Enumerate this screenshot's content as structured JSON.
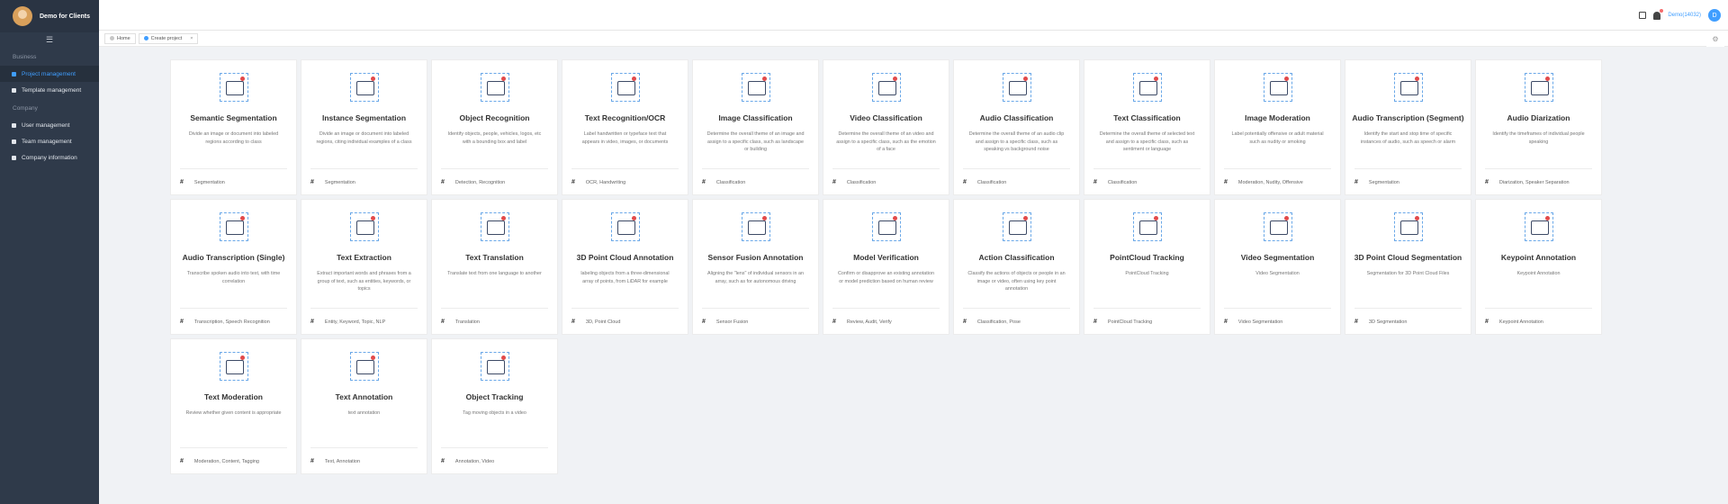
{
  "app": {
    "title": "Demo for Clients"
  },
  "sidebar": {
    "groups": [
      {
        "label": "Business",
        "items": [
          {
            "label": "Project management",
            "active": true
          },
          {
            "label": "Template management",
            "active": false
          }
        ]
      },
      {
        "label": "Company",
        "items": [
          {
            "label": "User management",
            "active": false
          },
          {
            "label": "Team management",
            "active": false
          },
          {
            "label": "Company information",
            "active": false
          }
        ]
      }
    ]
  },
  "header": {
    "username": "Demo(14032)",
    "avatar_letter": "D"
  },
  "tabs": [
    {
      "label": "Home",
      "active": false,
      "closable": false
    },
    {
      "label": "Create project",
      "active": true,
      "closable": true
    }
  ],
  "cards": [
    {
      "title": "Semantic Segmentation",
      "desc": "Divide an image or document into labeled regions according to class",
      "tags": [
        "Segmentation"
      ],
      "icon": "semantic-segmentation-icon"
    },
    {
      "title": "Instance Segmentation",
      "desc": "Divide an image or document into labeled regions, citing individual examples of a class",
      "tags": [
        "Segmentation"
      ],
      "icon": "instance-segmentation-icon"
    },
    {
      "title": "Object Recognition",
      "desc": "Identify objects, people, vehicles, logos, etc with a bounding box and label",
      "tags": [
        "Detection, Recognition"
      ],
      "icon": "object-recognition-icon"
    },
    {
      "title": "Text Recognition/OCR",
      "desc": "Label handwritten or typeface text that appears in video, images, or documents",
      "tags": [
        "OCR, Handwriting"
      ],
      "icon": "ocr-icon"
    },
    {
      "title": "Image Classification",
      "desc": "Determine the overall theme of an image and assign to a specific class, such as landscape or building",
      "tags": [
        "Classification"
      ],
      "icon": "image-classification-icon"
    },
    {
      "title": "Video Classification",
      "desc": "Determine the overall theme of an video and assign to a specific class, such as the emotion of a face",
      "tags": [
        "Classification"
      ],
      "icon": "video-classification-icon"
    },
    {
      "title": "Audio Classification",
      "desc": "Determine the overall theme of an audio clip and assign to a specific class, such as speaking vs background noise",
      "tags": [
        "Classification"
      ],
      "icon": "audio-classification-icon"
    },
    {
      "title": "Text Classification",
      "desc": "Determine the overall theme of selected text and assign to a specific class, such as sentiment or language",
      "tags": [
        "Classification"
      ],
      "icon": "text-classification-icon"
    },
    {
      "title": "Image Moderation",
      "desc": "Label potentially offensive or adult material such as nudity or smoking",
      "tags": [
        "Moderation, Nudity, Offensive"
      ],
      "icon": "image-moderation-icon"
    },
    {
      "title": "Audio Transcription (Segment)",
      "desc": "Identify the start and stop time of specific instances of audio, such as speech or alarm",
      "tags": [
        "Segmentation"
      ],
      "icon": "audio-transcription-segment-icon"
    },
    {
      "title": "Audio Diarization",
      "desc": "Identify the timeframes of individual people speaking",
      "tags": [
        "Diarization, Speaker Separation"
      ],
      "icon": "audio-diarization-icon"
    },
    {
      "title": "Audio Transcription (Single)",
      "desc": "Transcribe spoken audio into text, with time correlation",
      "tags": [
        "Transcription, Speech Recognition"
      ],
      "icon": "audio-transcription-single-icon"
    },
    {
      "title": "Text Extraction",
      "desc": "Extract important words and phrases from a group of text, such as entities, keywords, or topics",
      "tags": [
        "Entity, Keyword, Topic, NLP"
      ],
      "icon": "text-extraction-icon"
    },
    {
      "title": "Text Translation",
      "desc": "Translate text from one language to another",
      "tags": [
        "Translation"
      ],
      "icon": "text-translation-icon"
    },
    {
      "title": "3D Point Cloud Annotation",
      "desc": "labeling objects from a three-dimensional array of points, from LiDAR for example",
      "tags": [
        "3D, Point Cloud"
      ],
      "icon": "point-cloud-annotation-icon"
    },
    {
      "title": "Sensor Fusion Annotation",
      "desc": "Aligning the \"lens\" of individual sensors in an array, such as for autonomous driving",
      "tags": [
        "Sensor Fusion"
      ],
      "icon": "sensor-fusion-icon"
    },
    {
      "title": "Model Verification",
      "desc": "Confirm or disapprove an existing annotation or model prediction based on human review",
      "tags": [
        "Review, Audit, Verify"
      ],
      "icon": "model-verification-icon"
    },
    {
      "title": "Action Classification",
      "desc": "Classify the actions of objects or people in an image or video, often using key point annotation",
      "tags": [
        "Classification, Pose"
      ],
      "icon": "action-classification-icon"
    },
    {
      "title": "PointCloud Tracking",
      "desc": "PointCloud Tracking",
      "tags": [
        "PointCloud Tracking"
      ],
      "icon": "pointcloud-tracking-icon"
    },
    {
      "title": "Video Segmentation",
      "desc": "Video Segmentation",
      "tags": [
        "Video Segmentation"
      ],
      "icon": "video-segmentation-icon"
    },
    {
      "title": "3D Point Cloud Segmentation",
      "desc": "Segmentation for 3D Point Cloud Files",
      "tags": [
        "3D Segmentation"
      ],
      "icon": "point-cloud-segmentation-icon"
    },
    {
      "title": "Keypoint Annotation",
      "desc": "Keypoint Annotation",
      "tags": [
        "Keypoint Annotation"
      ],
      "icon": "keypoint-annotation-icon"
    },
    {
      "title": "Text Moderation",
      "desc": "Review whether given content is appropriate",
      "tags": [
        "Moderation,  Content,  Tagging"
      ],
      "icon": "text-moderation-icon"
    },
    {
      "title": "Text Annotation",
      "desc": "text annotation",
      "tags": [
        "Text, Annotation"
      ],
      "icon": "text-annotation-icon"
    },
    {
      "title": "Object Tracking",
      "desc": "Tag moving objects in a video",
      "tags": [
        "Annotation,  Video"
      ],
      "icon": "object-tracking-icon"
    }
  ]
}
